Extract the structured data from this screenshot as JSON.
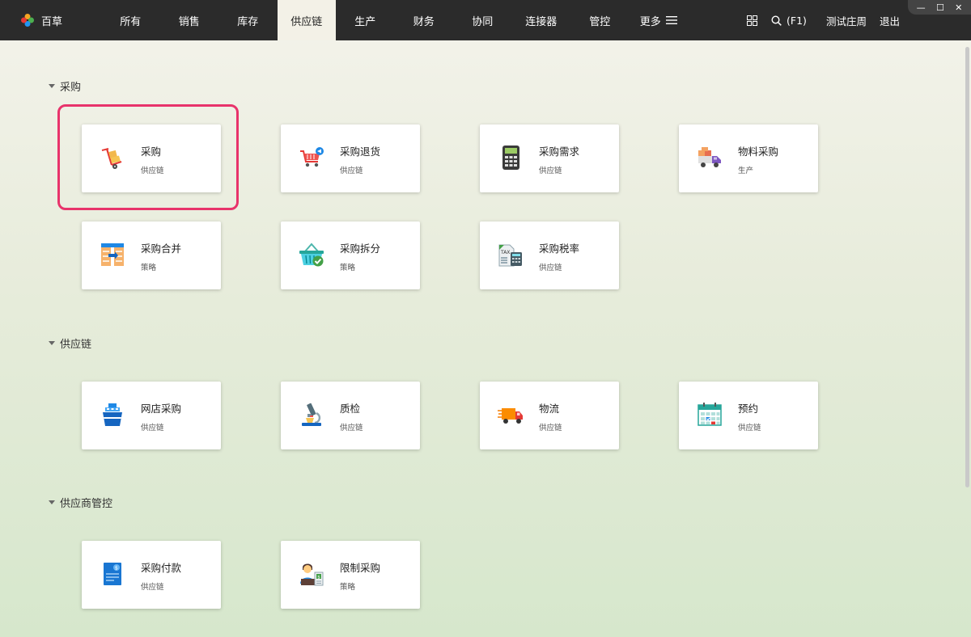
{
  "app": {
    "name": "百草"
  },
  "nav": [
    {
      "label": "所有"
    },
    {
      "label": "销售"
    },
    {
      "label": "库存"
    },
    {
      "label": "供应链",
      "active": true
    },
    {
      "label": "生产"
    },
    {
      "label": "财务"
    },
    {
      "label": "协同"
    },
    {
      "label": "连接器"
    },
    {
      "label": "管控"
    },
    {
      "label": "更多"
    }
  ],
  "toolbar": {
    "search_label": "(F1)",
    "user": "测试庄周",
    "logout": "退出"
  },
  "sections": [
    {
      "title": "采购",
      "cards": [
        {
          "title": "采购",
          "sub": "供应链",
          "icon": "hand-truck-boxes-icon"
        },
        {
          "title": "采购退货",
          "sub": "供应链",
          "icon": "cart-return-icon"
        },
        {
          "title": "采购需求",
          "sub": "供应链",
          "icon": "calculator-icon"
        },
        {
          "title": "物料采购",
          "sub": "生产",
          "icon": "delivery-van-icon"
        },
        {
          "title": "采购合并",
          "sub": "策略",
          "icon": "merge-table-icon"
        },
        {
          "title": "采购拆分",
          "sub": "策略",
          "icon": "basket-check-icon"
        },
        {
          "title": "采购税率",
          "sub": "供应链",
          "icon": "tax-calculator-icon"
        }
      ]
    },
    {
      "title": "供应链",
      "cards": [
        {
          "title": "网店采购",
          "sub": "供应链",
          "icon": "cargo-ship-icon"
        },
        {
          "title": "质检",
          "sub": "供应链",
          "icon": "microscope-icon"
        },
        {
          "title": "物流",
          "sub": "供应链",
          "icon": "fast-truck-icon"
        },
        {
          "title": "预约",
          "sub": "供应链",
          "icon": "calendar-check-icon"
        }
      ]
    },
    {
      "title": "供应商管控",
      "cards": [
        {
          "title": "采购付款",
          "sub": "供应链",
          "icon": "payment-document-icon"
        },
        {
          "title": "限制采购",
          "sub": "策略",
          "icon": "person-money-icon"
        }
      ]
    }
  ],
  "colors": {
    "topbar": "#2b2b2b",
    "active_tab_bg": "#f3f1e7",
    "highlight": "#e8336b"
  }
}
